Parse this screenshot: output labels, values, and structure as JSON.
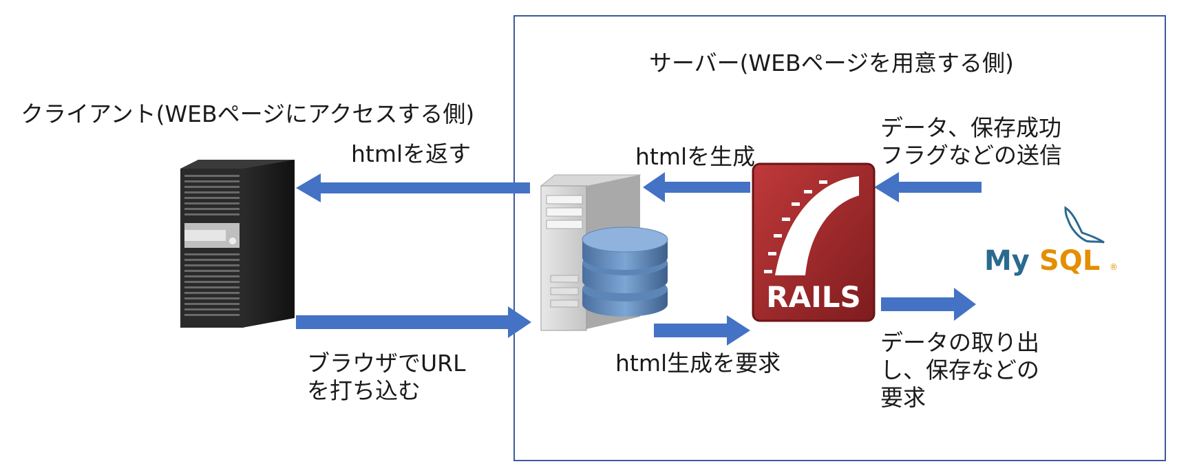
{
  "server_title": "サーバー(WEBページを用意する側)",
  "client_title": "クライアント(WEBページにアクセスする側)",
  "labels": {
    "return_html": "htmlを返す",
    "generate_html": "htmlを生成",
    "data_result": "データ、保存成功\nフラグなどの送信",
    "url_input": "ブラウザでURL\nを打ち込む",
    "request_html": "html生成を要求",
    "request_data": "データの取り出\nし、保存などの\n要求"
  },
  "logos": {
    "rails": "RAILS",
    "mysql_my": "My",
    "mysql_sql": "SQL",
    "mysql_reg": "®"
  },
  "colors": {
    "arrow": "#4472c4",
    "box_border": "#3a5a9a",
    "rails_red": "#a4282a",
    "mysql_blue": "#2a6a90",
    "mysql_orange": "#e48e00"
  }
}
